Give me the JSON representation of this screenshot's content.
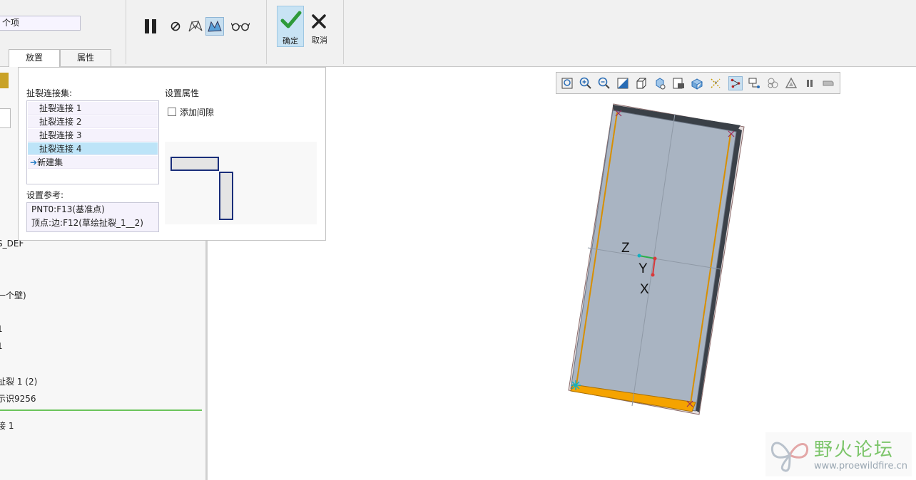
{
  "ribbon": {
    "field_value": "个项",
    "tabs": [
      {
        "label": "放置"
      },
      {
        "label": "属性"
      }
    ],
    "tools": [
      {
        "icon": "pause-icon"
      },
      {
        "icon": "no-preview-icon"
      },
      {
        "icon": "wireframe-preview-icon"
      },
      {
        "icon": "solid-preview-icon",
        "active": true
      },
      {
        "icon": "glasses-icon"
      }
    ],
    "ok_label": "确定",
    "cancel_label": "取消"
  },
  "model_tree": {
    "items": [
      {
        "label": "S_DEF"
      },
      {
        "label": "一个壁)"
      },
      {
        "label": "1"
      },
      {
        "label": "1"
      },
      {
        "label": "扯裂 1 (2)"
      },
      {
        "label": "示识9256"
      },
      {
        "label": "接 1"
      }
    ]
  },
  "placement_panel": {
    "rip_sets_label": "扯裂连接集:",
    "rip_sets": [
      {
        "label": "扯裂连接 1"
      },
      {
        "label": "扯裂连接 2"
      },
      {
        "label": "扯裂连接 3"
      },
      {
        "label": "扯裂连接 4",
        "selected": true
      }
    ],
    "new_set_label": "新建集",
    "refs_label": "设置参考:",
    "refs": [
      {
        "label": "PNT0:F13(基准点)"
      },
      {
        "label": "顶点:边:F12(草绘扯裂_1__2)"
      }
    ],
    "props_label": "设置属性",
    "add_gap_label": "添加间隙",
    "add_gap_checked": false
  },
  "view_toolbar": {
    "icons": [
      "refit-icon",
      "zoom-in-icon",
      "zoom-out-icon",
      "repaint-icon",
      "display-style-icon",
      "saved-orientations-icon",
      "view-manager-icon",
      "perspective-icon",
      "datum-display-icon",
      "spin-center-icon",
      "annotation-display-icon",
      "layer-icon",
      "appearance-icon",
      "pause-icon",
      "toggle-icon"
    ]
  },
  "viewport": {
    "axis_labels": {
      "z": "Z",
      "y": "Y",
      "x": "X"
    }
  },
  "watermark": {
    "title": "野火论坛",
    "url": "www.proewildfire.cn"
  },
  "colors": {
    "accent": "#1f78c1",
    "selection": "#bde4f8",
    "model_face": "#a9b4c2",
    "rip_edge": "#f5a300",
    "watermark_green": "#7cc56a"
  }
}
